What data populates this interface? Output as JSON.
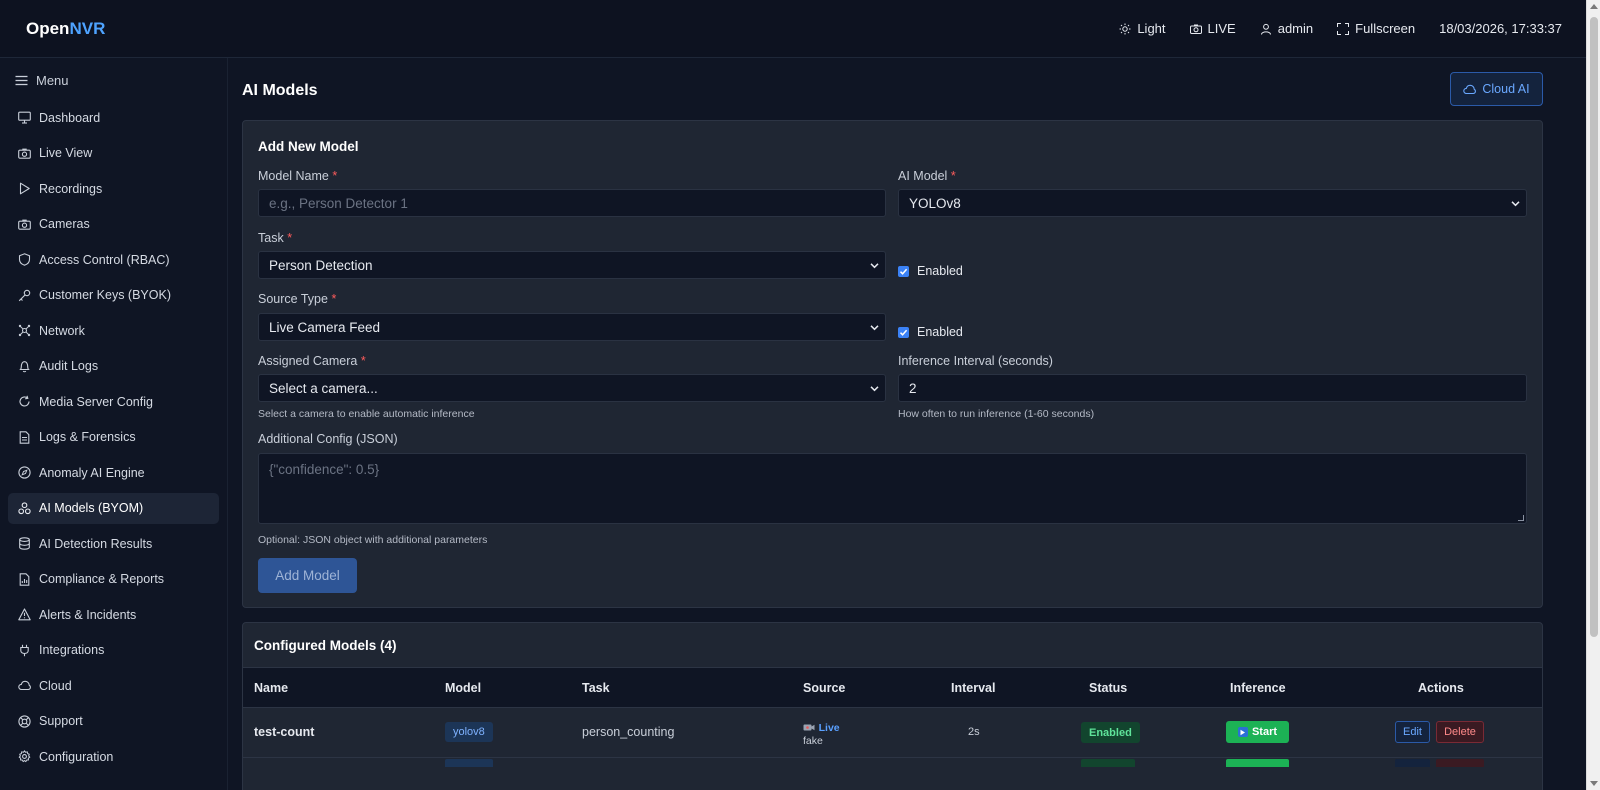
{
  "app": {
    "brand_prefix": "Open",
    "brand_accent": "NVR",
    "theme_toggle": "Light",
    "live_label": "LIVE",
    "user": "admin",
    "fullscreen": "Fullscreen",
    "datetime": "18/03/2026, 17:33:37"
  },
  "sidebar": {
    "menu_label": "Menu",
    "items": [
      {
        "label": "Dashboard",
        "icon": "monitor-icon"
      },
      {
        "label": "Live View",
        "icon": "camera-icon"
      },
      {
        "label": "Recordings",
        "icon": "play-icon"
      },
      {
        "label": "Cameras",
        "icon": "camera-icon"
      },
      {
        "label": "Access Control (RBAC)",
        "icon": "shield-icon"
      },
      {
        "label": "Customer Keys (BYOK)",
        "icon": "key-icon"
      },
      {
        "label": "Network",
        "icon": "network-icon"
      },
      {
        "label": "Audit Logs",
        "icon": "bell-icon"
      },
      {
        "label": "Media Server Config",
        "icon": "refresh-icon"
      },
      {
        "label": "Logs & Forensics",
        "icon": "file-icon"
      },
      {
        "label": "Anomaly AI Engine",
        "icon": "compass-icon"
      },
      {
        "label": "AI Models (BYOM)",
        "icon": "cluster-icon",
        "active": true
      },
      {
        "label": "AI Detection Results",
        "icon": "database-icon"
      },
      {
        "label": "Compliance & Reports",
        "icon": "report-icon"
      },
      {
        "label": "Alerts & Incidents",
        "icon": "alert-icon"
      },
      {
        "label": "Integrations",
        "icon": "plug-icon"
      },
      {
        "label": "Cloud",
        "icon": "cloud-icon"
      },
      {
        "label": "Support",
        "icon": "lifebuoy-icon"
      },
      {
        "label": "Configuration",
        "icon": "gear-icon"
      }
    ]
  },
  "page": {
    "title": "AI Models",
    "cloud_button": "Cloud AI"
  },
  "form": {
    "title": "Add New Model",
    "model_name_label": "Model Name",
    "model_name_placeholder": "e.g., Person Detector 1",
    "ai_model_label": "AI Model",
    "ai_model_value": "YOLOv8",
    "task_label": "Task",
    "task_value": "Person Detection",
    "enabled_label_1": "Enabled",
    "source_type_label": "Source Type",
    "source_type_value": "Live Camera Feed",
    "enabled_label_2": "Enabled",
    "camera_label": "Assigned Camera",
    "camera_value": "Select a camera...",
    "camera_hint": "Select a camera to enable automatic inference",
    "interval_label": "Inference Interval (seconds)",
    "interval_value": "2",
    "interval_hint": "How often to run inference (1-60 seconds)",
    "config_label": "Additional Config (JSON)",
    "config_placeholder": "{\"confidence\": 0.5}",
    "config_hint": "Optional: JSON object with additional parameters",
    "required_mark": "*",
    "submit": "Add Model"
  },
  "table": {
    "title": "Configured Models (4)",
    "columns": [
      "Name",
      "Model",
      "Task",
      "Source",
      "Interval",
      "Status",
      "Inference",
      "Actions"
    ],
    "rows": [
      {
        "name": "test-count",
        "model": "yolov8",
        "task": "person_counting",
        "source_type": "Live",
        "source_camera": "fake",
        "interval": "2s",
        "status": "Enabled",
        "inference": "Start",
        "edit": "Edit",
        "delete": "Delete"
      }
    ]
  },
  "colors": {
    "accent": "#4ea3ff",
    "background": "#0f1524",
    "card": "#1f2633",
    "success": "#1cb255",
    "danger": "#ff8a8a"
  }
}
